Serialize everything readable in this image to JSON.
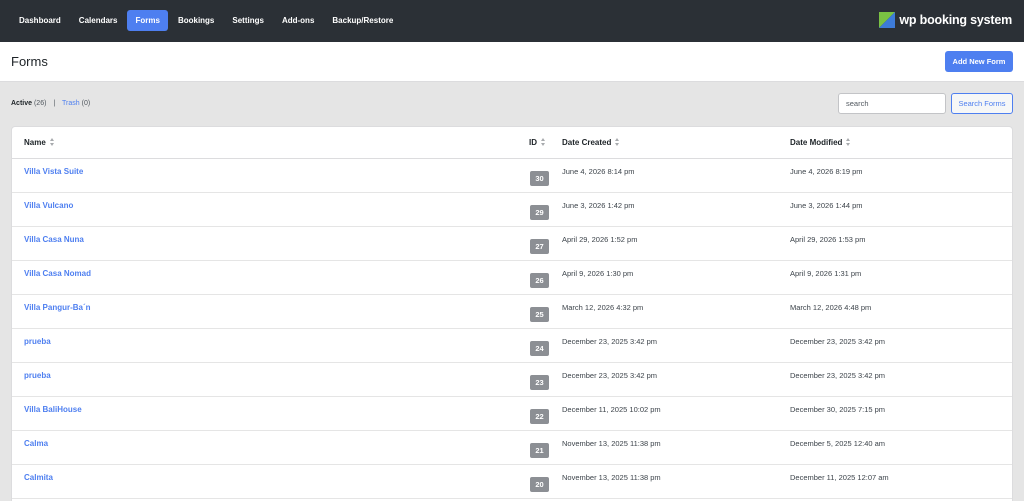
{
  "nav": {
    "items": [
      {
        "label": "Dashboard"
      },
      {
        "label": "Calendars"
      },
      {
        "label": "Forms",
        "active": true
      },
      {
        "label": "Bookings"
      },
      {
        "label": "Settings"
      },
      {
        "label": "Add-ons"
      },
      {
        "label": "Backup/Restore"
      }
    ],
    "brand": "wp booking system",
    "brand_colors": {
      "green": "#7ac143",
      "blue": "#3d7bd9"
    }
  },
  "page": {
    "title": "Forms",
    "add_button": "Add New Form"
  },
  "filters": {
    "active_label": "Active",
    "active_count": "(26)",
    "separator": "|",
    "trash_label": "Trash",
    "trash_count": "(0)"
  },
  "search": {
    "placeholder": "search",
    "button": "Search Forms"
  },
  "table": {
    "columns": {
      "name": "Name",
      "id": "ID",
      "created": "Date Created",
      "modified": "Date Modified"
    },
    "rows": [
      {
        "name": "Villa Vista Suite",
        "id": "30",
        "created": "June 4, 2026 8:14 pm",
        "modified": "June 4, 2026 8:19 pm"
      },
      {
        "name": "Villa Vulcano",
        "id": "29",
        "created": "June 3, 2026 1:42 pm",
        "modified": "June 3, 2026 1:44 pm"
      },
      {
        "name": "Villa Casa Nuna",
        "id": "27",
        "created": "April 29, 2026 1:52 pm",
        "modified": "April 29, 2026 1:53 pm"
      },
      {
        "name": "Villa Casa Nomad",
        "id": "26",
        "created": "April 9, 2026 1:30 pm",
        "modified": "April 9, 2026 1:31 pm"
      },
      {
        "name": "Villa Pangur-Ba´n",
        "id": "25",
        "created": "March 12, 2026 4:32 pm",
        "modified": "March 12, 2026 4:48 pm"
      },
      {
        "name": "prueba",
        "id": "24",
        "created": "December 23, 2025 3:42 pm",
        "modified": "December 23, 2025 3:42 pm"
      },
      {
        "name": "prueba",
        "id": "23",
        "created": "December 23, 2025 3:42 pm",
        "modified": "December 23, 2025 3:42 pm"
      },
      {
        "name": "Villa BaliHouse",
        "id": "22",
        "created": "December 11, 2025 10:02 pm",
        "modified": "December 30, 2025 7:15 pm"
      },
      {
        "name": "Calma",
        "id": "21",
        "created": "November 13, 2025 11:38 pm",
        "modified": "December 5, 2025 12:40 am"
      },
      {
        "name": "Calmita",
        "id": "20",
        "created": "November 13, 2025 11:38 pm",
        "modified": "December 11, 2025 12:07 am"
      }
    ]
  },
  "colors": {
    "accent": "#4e7ff0",
    "topbar": "#2b3036",
    "id_badge": "#8c8f94"
  }
}
